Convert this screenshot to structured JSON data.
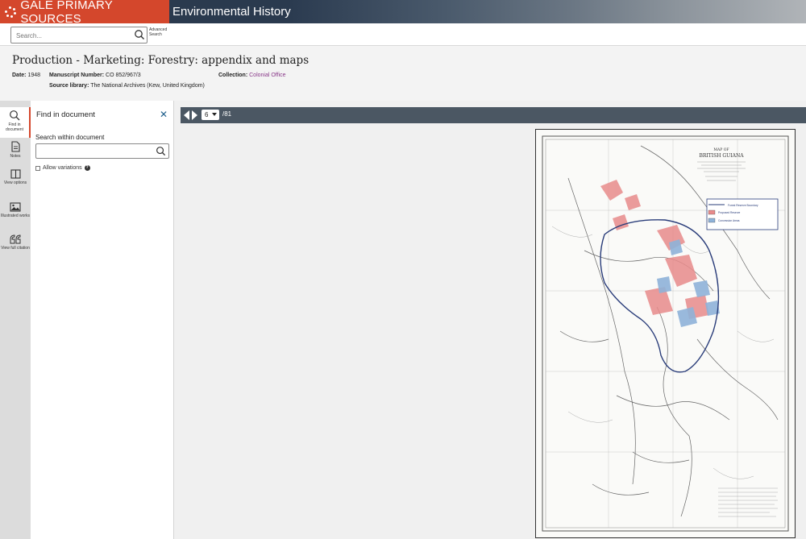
{
  "brand": {
    "name": "GALE PRIMARY SOURCES",
    "collection": "Environmental History"
  },
  "search": {
    "placeholder": "Search...",
    "advanced_label": "Advanced Search"
  },
  "document": {
    "title": "Production - Marketing: Forestry: appendix and maps",
    "date_label": "Date:",
    "date": "1948",
    "manuscript_label": "Manuscript Number:",
    "manuscript": "CO 852/967/3",
    "collection_label": "Collection:",
    "collection": "Colonial Office",
    "source_label": "Source library:",
    "source": "The National Archives (Kew, United Kingdom)"
  },
  "rail": {
    "items": [
      {
        "label": "Find in document",
        "icon": "search-icon"
      },
      {
        "label": "Notes",
        "icon": "notes-icon"
      },
      {
        "label": "View options",
        "icon": "view-options-icon"
      },
      {
        "label": "Illustrated works",
        "icon": "image-icon"
      },
      {
        "label": "View full citation",
        "icon": "quote-icon"
      }
    ]
  },
  "find": {
    "title": "Find in document",
    "search_label": "Search within document",
    "search_value": "",
    "allow_variations": "Allow variations"
  },
  "viewer": {
    "current_page": "6",
    "total_pages": "/81"
  },
  "map": {
    "title": "MAP OF",
    "subtitle": "BRITISH GUIANA",
    "legend": [
      "Forest Reserve Boundary",
      "Proposed Reserve",
      "Concession Areas"
    ],
    "colors": {
      "red_area": "#e88b8b",
      "blue_area": "#8fb3d9",
      "boundary": "#2a3d7a"
    }
  },
  "colors": {
    "brand": "#d4472c",
    "toolbar": "#4b5763",
    "link": "#8a3a8a",
    "close": "#1f5f8b"
  }
}
